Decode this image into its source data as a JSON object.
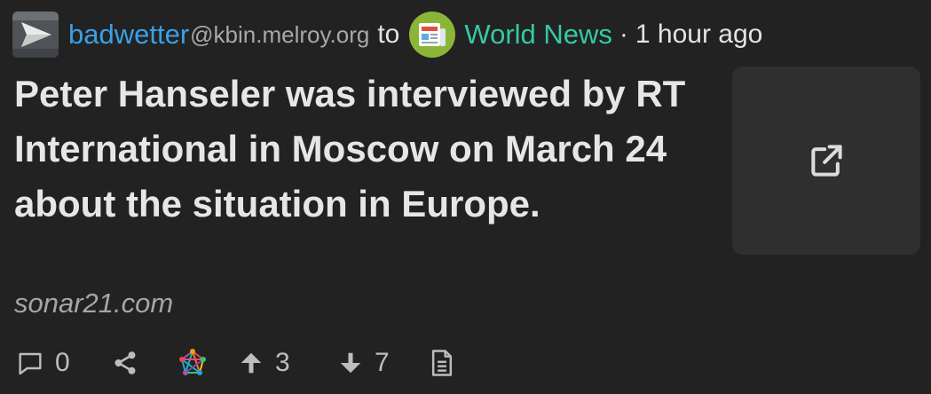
{
  "header": {
    "username": "badwetter",
    "instance": "@kbin.melroy.org",
    "to_word": "to",
    "magazine": "World News",
    "separator": "·",
    "time": "1 hour ago",
    "avatar_icon": "play-arrow-avatar-icon",
    "magazine_icon": "newspaper-icon"
  },
  "post": {
    "title": "Peter Hanseler was interviewed by RT International in Moscow on March 24 about the situation in Europe.",
    "domain": "sonar21.com",
    "thumbnail_icon": "external-link-icon"
  },
  "actions": {
    "comments_count": "0",
    "upvotes": "3",
    "downvotes": "7",
    "icons": [
      "comment-icon",
      "share-icon",
      "fediverse-icon",
      "upvote-arrow-icon",
      "downvote-arrow-icon",
      "document-icon"
    ]
  },
  "colors": {
    "background": "#222222",
    "username": "#3c9fe6",
    "magazine": "#35c9a3",
    "magazine_badge": "#8bb537",
    "thumbnail_bg": "#2f2f2f",
    "text": "#e3e3e3",
    "muted": "#a6a6a6"
  }
}
